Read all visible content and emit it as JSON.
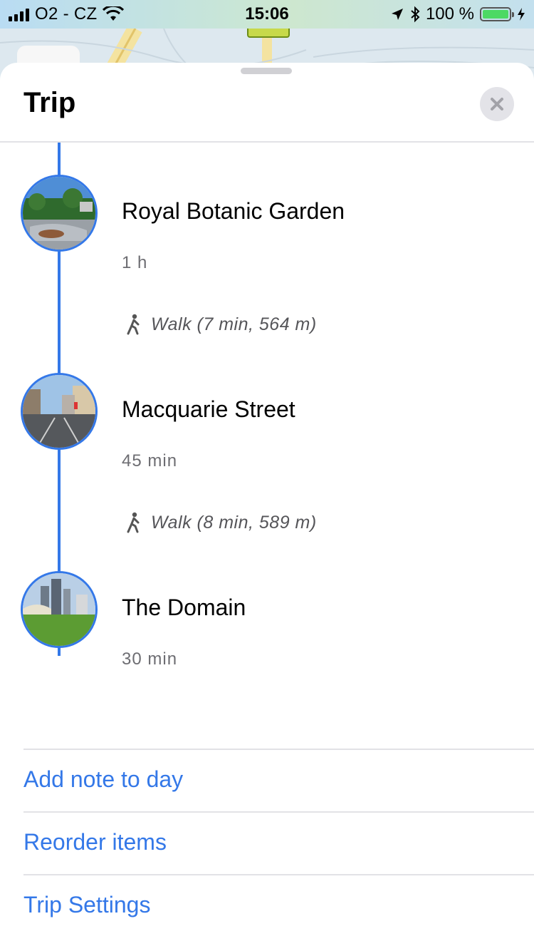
{
  "status_bar": {
    "carrier": "O2 - CZ",
    "time": "15:06",
    "battery": "100 %",
    "battery_level": 1.0
  },
  "sheet": {
    "title": "Trip",
    "close_icon": "close-icon"
  },
  "stops": [
    {
      "name": "Royal Botanic Garden",
      "duration": "1 h",
      "walk_after": "Walk (7 min, 564 m)"
    },
    {
      "name": "Macquarie Street",
      "duration": "45 min",
      "walk_after": "Walk (8 min, 589 m)"
    },
    {
      "name": "The Domain",
      "duration": "30 min"
    }
  ],
  "actions": {
    "add_note": "Add note to day",
    "reorder": "Reorder items",
    "settings": "Trip Settings"
  },
  "colors": {
    "accent": "#3478e8",
    "battery_fill": "#4cd964"
  }
}
